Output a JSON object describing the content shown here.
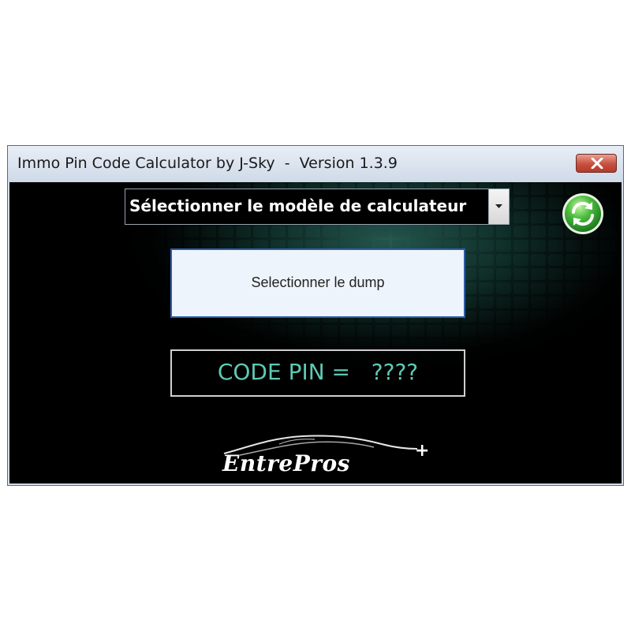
{
  "window": {
    "title": "Immo Pin Code Calculator by J-Sky  -  Version 1.3.9"
  },
  "model_select": {
    "selected": "Sélectionner le modèle de calculateur"
  },
  "dump_button": {
    "label": "Selectionner le dump"
  },
  "pin": {
    "label": "CODE PIN =   ????"
  },
  "logo": {
    "text": "EntrePros",
    "suffix": "+"
  },
  "icons": {
    "close": "close-icon",
    "dropdown": "chevron-down-icon",
    "refresh": "refresh-icon"
  },
  "colors": {
    "pin_text": "#5ec9b5",
    "close_button": "#c8503e",
    "dump_border": "#2d5ea8",
    "refresh_green": "#3aa53a"
  }
}
